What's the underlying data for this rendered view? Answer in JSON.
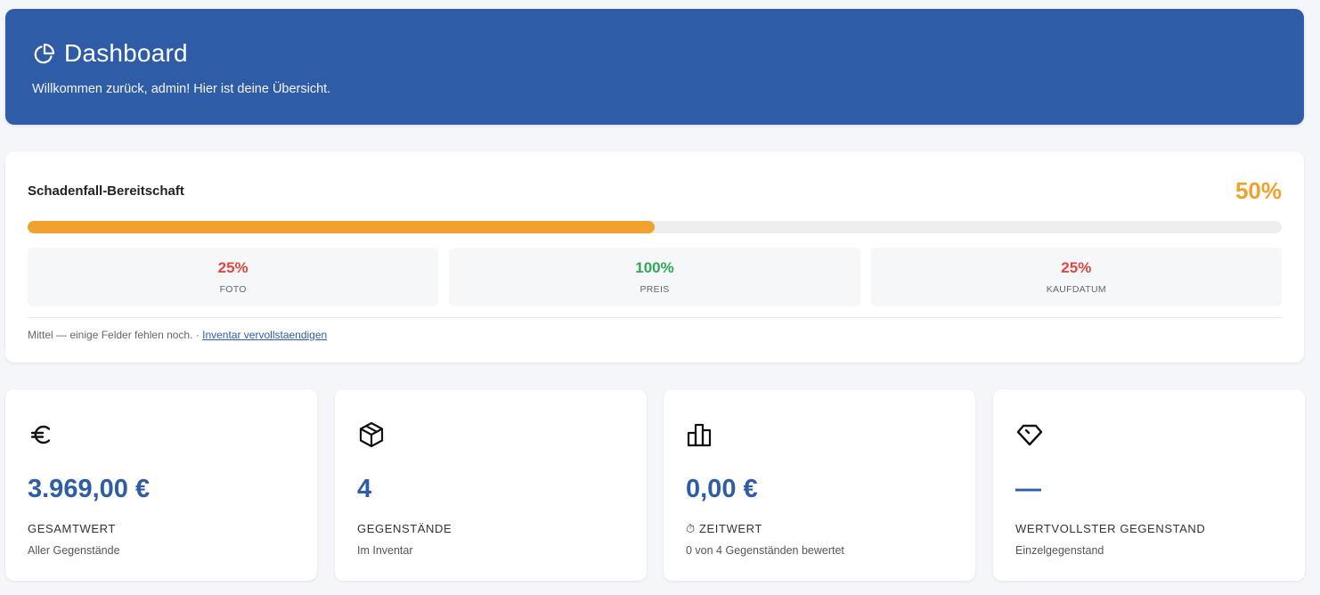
{
  "header": {
    "title": "Dashboard",
    "subtitle": "Willkommen zurück, admin! Hier ist deine Übersicht.",
    "icon": "pie-chart-icon"
  },
  "readiness": {
    "title": "Schadenfall-Bereitschaft",
    "percent_label": "50%",
    "progress": 0.5,
    "metrics": [
      {
        "value": "25%",
        "label": "FOTO",
        "color": "#e0463f"
      },
      {
        "value": "100%",
        "label": "PREIS",
        "color": "#2fa85a"
      },
      {
        "value": "25%",
        "label": "KAUFDATUM",
        "color": "#e0463f"
      }
    ],
    "footer_text": "Mittel — einige Felder fehlen noch.",
    "footer_sep": " · ",
    "footer_link": "Inventar vervollstaendigen"
  },
  "stats": [
    {
      "icon": "euro-icon",
      "value": "3.969,00 €",
      "label": "GESAMTWERT",
      "sub": "Aller Gegenstände"
    },
    {
      "icon": "box-icon",
      "value": "4",
      "label": "GEGENSTÄNDE",
      "sub": "Im Inventar"
    },
    {
      "icon": "bar-chart-icon",
      "value": "0,00 €",
      "label": "⏱ ZEITWERT",
      "sub": "0 von 4 Gegenständen bewertet"
    },
    {
      "icon": "diamond-icon",
      "value": "—",
      "label": "WERTVOLLSTER GEGENSTAND",
      "sub": "Einzelgegenstand"
    }
  ],
  "colors": {
    "primary": "#2f5ca6",
    "warning": "#f0a12e",
    "danger": "#e0463f",
    "success": "#2fa85a"
  }
}
